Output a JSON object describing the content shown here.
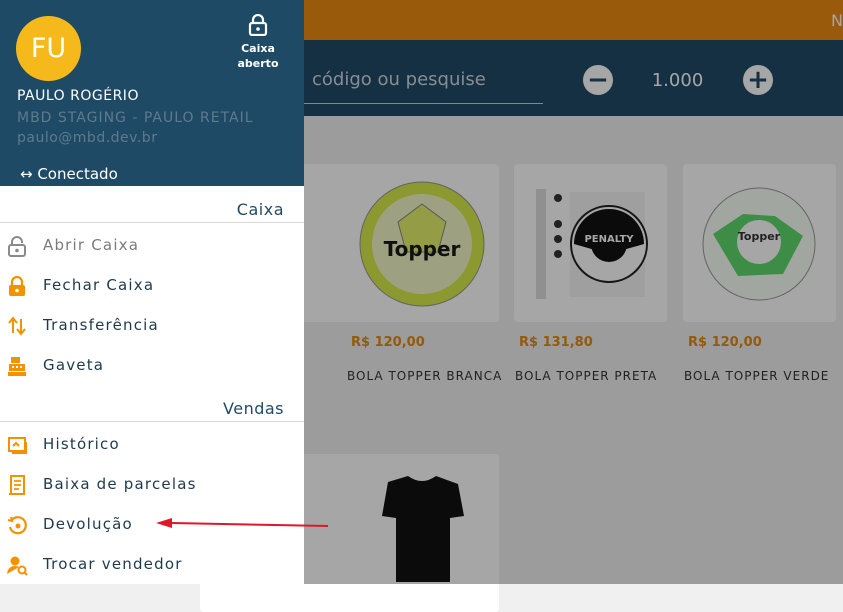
{
  "app": {
    "top_right_text": "N"
  },
  "search": {
    "placeholder": "código ou pesquise"
  },
  "quantity": {
    "value": "1.000",
    "minus": "−",
    "plus": "+"
  },
  "products": [
    {
      "price": "R$ 120,00",
      "name": "BOLA TOPPER BRANCA"
    },
    {
      "price": "R$ 131,80",
      "name": "BOLA TOPPER PRETA"
    },
    {
      "price": "R$ 120,00",
      "name": "BOLA TOPPER VERDE"
    }
  ],
  "user": {
    "initials": "FU",
    "name": "PAULO ROGÉRIO",
    "company": "MBD STAGING - PAULO RETAIL",
    "email": "paulo@mbd.dev.br",
    "status": "↔ Conectado"
  },
  "register_status": {
    "line1": "Caixa",
    "line2": "aberto",
    "icon": "lock-icon"
  },
  "sections": {
    "caixa": {
      "title": "Caixa",
      "items": [
        {
          "label": "Abrir Caixa",
          "icon": "lock-open-icon",
          "enabled": false
        },
        {
          "label": "Fechar Caixa",
          "icon": "lock-icon",
          "enabled": true
        },
        {
          "label": "Transferência",
          "icon": "transfer-icon",
          "enabled": true
        },
        {
          "label": "Gaveta",
          "icon": "cash-register-icon",
          "enabled": true
        }
      ]
    },
    "vendas": {
      "title": "Vendas",
      "items": [
        {
          "label": "Histórico",
          "icon": "history-icon",
          "enabled": true
        },
        {
          "label": "Baixa de parcelas",
          "icon": "receipt-icon",
          "enabled": true
        },
        {
          "label": "Devolução",
          "icon": "return-icon",
          "enabled": true
        },
        {
          "label": "Trocar vendedor",
          "icon": "user-search-icon",
          "enabled": true
        }
      ]
    }
  },
  "colors": {
    "primary": "#1f4a66",
    "accent": "#ec8a13",
    "avatar": "#f6b91b",
    "icon": "#f39200",
    "annotation": "#e0162b"
  }
}
